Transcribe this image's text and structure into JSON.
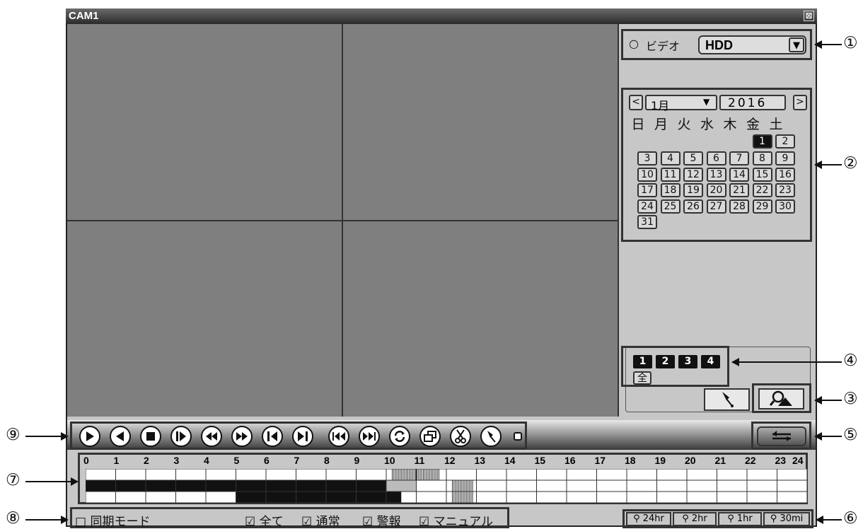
{
  "window": {
    "title": "CAM1",
    "close_glyph": "⊠"
  },
  "source": {
    "radio": "○",
    "label": "ビデオ",
    "value": "HDD",
    "dropdown_icon": "▼"
  },
  "calendar": {
    "prev": "<",
    "next": ">",
    "month": "1月",
    "month_icon": "▼",
    "year": "2016",
    "weekdays": [
      "日",
      "月",
      "火",
      "水",
      "木",
      "金",
      "土"
    ],
    "selected_day": "1",
    "days": [
      "1",
      "2",
      "3",
      "4",
      "5",
      "6",
      "7",
      "8",
      "9",
      "10",
      "11",
      "12",
      "13",
      "14",
      "15",
      "16",
      "17",
      "18",
      "19",
      "20",
      "21",
      "22",
      "23",
      "24",
      "25",
      "26",
      "27",
      "28",
      "29",
      "30",
      "31"
    ]
  },
  "channels": {
    "items": [
      "1",
      "2",
      "3",
      "4"
    ],
    "all_label": "全"
  },
  "callouts": {
    "c1": "①",
    "c2": "②",
    "c3": "③",
    "c4": "④",
    "c5": "⑤",
    "c6": "⑥",
    "c7": "⑦",
    "c8": "⑧",
    "c9": "⑨"
  },
  "timeline": {
    "hours": [
      "0",
      "1",
      "2",
      "3",
      "4",
      "5",
      "6",
      "7",
      "8",
      "9",
      "10",
      "11",
      "12",
      "13",
      "14",
      "15",
      "16",
      "17",
      "18",
      "19",
      "20",
      "21",
      "22",
      "23",
      "24"
    ]
  },
  "bottom": {
    "sync_label": "□ 同期モード",
    "all_label": "☑ 全て",
    "normal_label": "☑ 通常",
    "alarm_label": "☑ 警報",
    "manual_label": "☑ マニュアル"
  },
  "zoom": {
    "z24": "24hr",
    "z2": "2hr",
    "z1": "1hr",
    "z30": "30mi"
  },
  "colors": {
    "pane": "#7f7f7f",
    "window": "#c7c7c7",
    "record": "#111111"
  }
}
